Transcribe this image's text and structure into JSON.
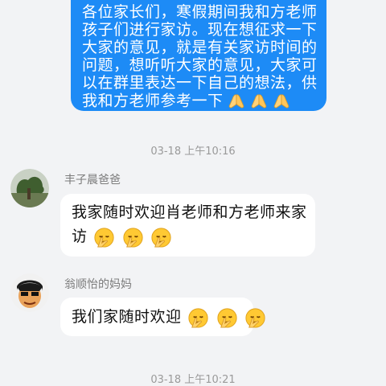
{
  "messages": {
    "outgoing": {
      "lines": [
        "各位家长们，寒假期间我和方老师将对",
        "孩子们进行家访。现在想征求一下",
        "大家的意见，就是有关家访时间的",
        "问题，想听听大家的意见，大家可",
        "以在群里表达一下自己的想法，供",
        "我和方老师参考一下"
      ],
      "emoji": "praying-hands-icon"
    },
    "time1": "03-18 上午10:16",
    "msg1": {
      "sender": "丰子晨爸爸",
      "line1": "我家随时欢迎肖老师和方老师来家",
      "line2": "访",
      "emoji": "salute-face-icon"
    },
    "msg2": {
      "sender": "翁顺怡的妈妈",
      "line1": "我们家随时欢迎",
      "emoji": "salute-face-icon"
    },
    "time2": "03-18 上午10:21"
  },
  "colors": {
    "background": "#f2f3f5",
    "outgoing_bubble": "#1d8bf6",
    "incoming_bubble": "#ffffff",
    "timestamp": "#9a9a9a"
  }
}
